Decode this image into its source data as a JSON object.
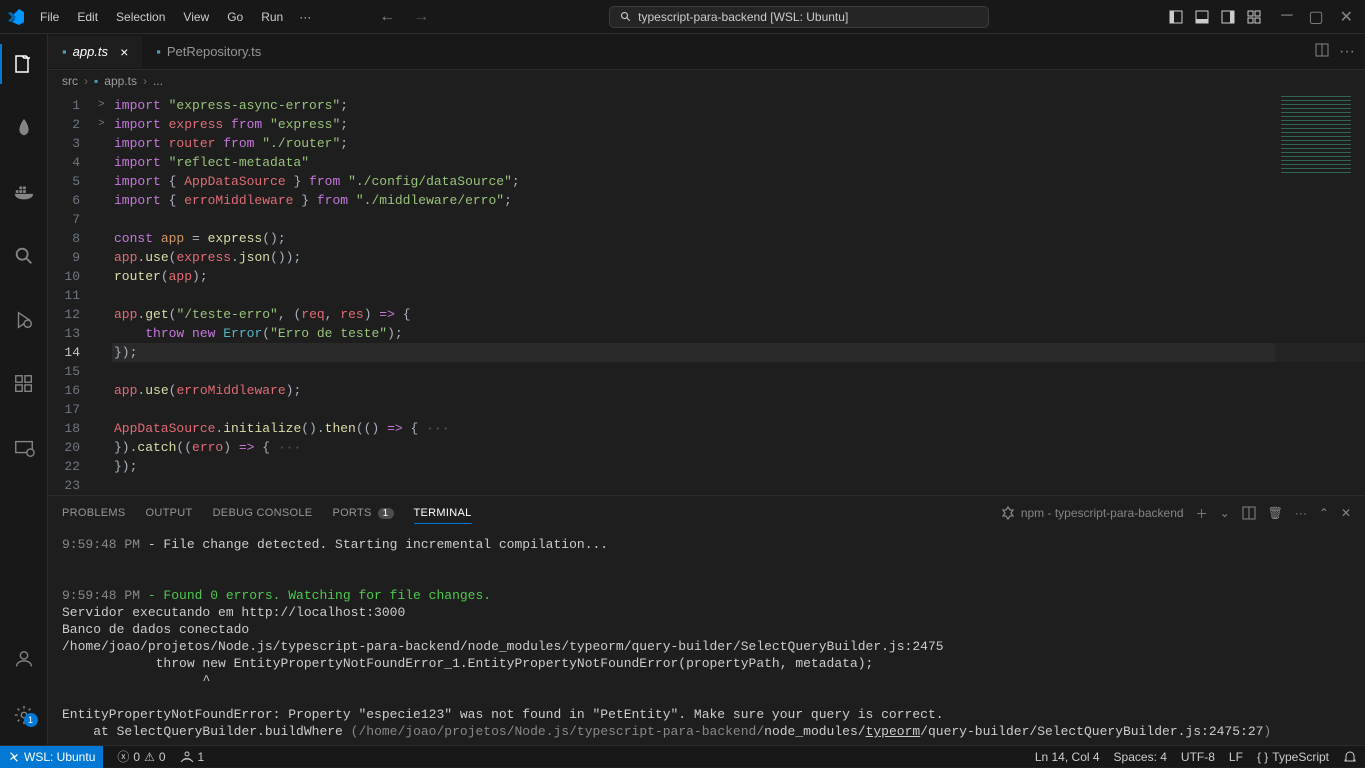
{
  "menu": [
    "File",
    "Edit",
    "Selection",
    "View",
    "Go",
    "Run"
  ],
  "search_text": "typescript-para-backend [WSL: Ubuntu]",
  "tabs": [
    {
      "label": "app.ts",
      "active": true,
      "italic": true,
      "close": true
    },
    {
      "label": "PetRepository.ts",
      "active": false
    }
  ],
  "breadcrumb": {
    "parts": [
      "src",
      "app.ts",
      "..."
    ]
  },
  "gutter": [
    "1",
    "2",
    "3",
    "4",
    "5",
    "6",
    "7",
    "8",
    "9",
    "10",
    "11",
    "12",
    "13",
    "14",
    "15",
    "16",
    "17",
    "18",
    "20",
    "22",
    "23"
  ],
  "current_line_idx": 13,
  "fold": {
    "17": ">",
    "18": ">"
  },
  "code_lines": [
    [
      [
        "kw",
        "import "
      ],
      [
        "str",
        "\"express-async-errors\""
      ],
      [
        "op",
        ";"
      ]
    ],
    [
      [
        "kw",
        "import "
      ],
      [
        "mod",
        "express"
      ],
      [
        "kw",
        " from "
      ],
      [
        "str",
        "\"express\""
      ],
      [
        "op",
        ";"
      ]
    ],
    [
      [
        "kw",
        "import "
      ],
      [
        "mod",
        "router"
      ],
      [
        "kw",
        " from "
      ],
      [
        "str",
        "\"./router\""
      ],
      [
        "op",
        ";"
      ]
    ],
    [
      [
        "kw",
        "import "
      ],
      [
        "str",
        "\"reflect-metadata\""
      ]
    ],
    [
      [
        "kw",
        "import "
      ],
      [
        "op",
        "{ "
      ],
      [
        "mod",
        "AppDataSource"
      ],
      [
        "op",
        " } "
      ],
      [
        "kw",
        "from "
      ],
      [
        "str",
        "\"./config/dataSource\""
      ],
      [
        "op",
        ";"
      ]
    ],
    [
      [
        "kw",
        "import "
      ],
      [
        "op",
        "{ "
      ],
      [
        "mod",
        "erroMiddleware"
      ],
      [
        "op",
        " } "
      ],
      [
        "kw",
        "from "
      ],
      [
        "str",
        "\"./middleware/erro\""
      ],
      [
        "op",
        ";"
      ]
    ],
    [],
    [
      [
        "kw",
        "const "
      ],
      [
        "const",
        "app"
      ],
      [
        "op",
        " = "
      ],
      [
        "fn",
        "express"
      ],
      [
        "op",
        "();"
      ]
    ],
    [
      [
        "var",
        "app"
      ],
      [
        "op",
        "."
      ],
      [
        "fn",
        "use"
      ],
      [
        "op",
        "("
      ],
      [
        "var",
        "express"
      ],
      [
        "op",
        "."
      ],
      [
        "fn",
        "json"
      ],
      [
        "op",
        "());"
      ]
    ],
    [
      [
        "fn",
        "router"
      ],
      [
        "op",
        "("
      ],
      [
        "var",
        "app"
      ],
      [
        "op",
        ");"
      ]
    ],
    [],
    [
      [
        "var",
        "app"
      ],
      [
        "op",
        "."
      ],
      [
        "fn",
        "get"
      ],
      [
        "op",
        "("
      ],
      [
        "str",
        "\"/teste-erro\""
      ],
      [
        "op",
        ", ("
      ],
      [
        "var",
        "req"
      ],
      [
        "op",
        ", "
      ],
      [
        "var",
        "res"
      ],
      [
        "op",
        ") "
      ],
      [
        "kw",
        "=>"
      ],
      [
        "op",
        " {"
      ]
    ],
    [
      [
        "op",
        "    "
      ],
      [
        "kw",
        "throw new "
      ],
      [
        "cls",
        "Error"
      ],
      [
        "op",
        "("
      ],
      [
        "str",
        "\"Erro de teste\""
      ],
      [
        "op",
        ");"
      ]
    ],
    [
      [
        "op",
        "});"
      ]
    ],
    [],
    [
      [
        "var",
        "app"
      ],
      [
        "op",
        "."
      ],
      [
        "fn",
        "use"
      ],
      [
        "op",
        "("
      ],
      [
        "var",
        "erroMiddleware"
      ],
      [
        "op",
        ");"
      ]
    ],
    [],
    [
      [
        "mod",
        "AppDataSource"
      ],
      [
        "op",
        "."
      ],
      [
        "fn",
        "initialize"
      ],
      [
        "op",
        "()."
      ],
      [
        "fn",
        "then"
      ],
      [
        "op",
        "(() "
      ],
      [
        "kw",
        "=>"
      ],
      [
        "op",
        " {"
      ],
      [
        "ghost",
        " ···"
      ]
    ],
    [
      [
        "op",
        "})."
      ],
      [
        "fn",
        "catch"
      ],
      [
        "op",
        "(("
      ],
      [
        "var",
        "erro"
      ],
      [
        "op",
        ") "
      ],
      [
        "kw",
        "=>"
      ],
      [
        "op",
        " {"
      ],
      [
        "ghost",
        " ···"
      ]
    ],
    [
      [
        "op",
        "});"
      ]
    ],
    []
  ],
  "panel_tabs": [
    {
      "label": "PROBLEMS"
    },
    {
      "label": "OUTPUT"
    },
    {
      "label": "DEBUG CONSOLE"
    },
    {
      "label": "PORTS",
      "badge": "1"
    },
    {
      "label": "TERMINAL",
      "active": true
    }
  ],
  "terminal_name": "npm - typescript-para-backend",
  "terminal": [
    {
      "time": "9:59:48 PM",
      "text": " - File change detected. Starting incremental compilation..."
    },
    {
      "blank": true
    },
    {
      "blank": true
    },
    {
      "time": "9:59:48 PM",
      "green": " - Found 0 errors. Watching for file changes."
    },
    {
      "text": "Servidor executando em http://localhost:3000"
    },
    {
      "text": "Banco de dados conectado"
    },
    {
      "text": "/home/joao/projetos/Node.js/typescript-para-backend/node_modules/typeorm/query-builder/SelectQueryBuilder.js:2475"
    },
    {
      "text": "            throw new EntityPropertyNotFoundError_1.EntityPropertyNotFoundError(propertyPath, metadata);"
    },
    {
      "text": "                  ^"
    },
    {
      "blank": true
    },
    {
      "text": "EntityPropertyNotFoundError: Property \"especie123\" was not found in \"PetEntity\". Make sure your query is correct."
    },
    {
      "mixed": [
        {
          "t": "    at SelectQueryBuilder.buildWhere "
        },
        {
          "c": "term-path",
          "t": "(/home/joao/projetos/Node.js/typescript-para-backend/"
        },
        {
          "t": "node_modules/"
        },
        {
          "c": "underline",
          "t": "typeorm"
        },
        {
          "t": "/query-builder/SelectQueryBuilder.js:2475:27"
        },
        {
          "c": "term-path",
          "t": ")"
        }
      ]
    }
  ],
  "status": {
    "remote": "WSL: Ubuntu",
    "errors": "0",
    "warnings": "0",
    "ports": "1",
    "ln": "Ln 14, Col 4",
    "spaces": "Spaces: 4",
    "encoding": "UTF-8",
    "eol": "LF",
    "lang": "TypeScript"
  }
}
